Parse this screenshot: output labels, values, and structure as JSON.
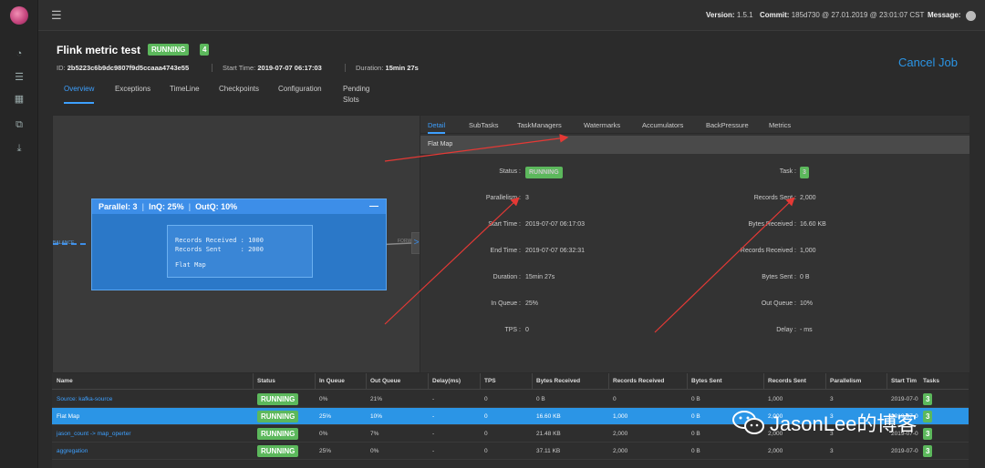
{
  "topbar": {
    "version_label": "Version:",
    "version": "1.5.1",
    "commit_label": "Commit:",
    "commit": "185d730 @ 27.01.2019 @ 23:01:07 CST",
    "message_label": "Message:"
  },
  "job": {
    "title": "Flink metric test",
    "status": "RUNNING",
    "tasks": "4",
    "id_label": "ID:",
    "id": "2b5223c6b9dc9807f9d5ccaaa4743e55",
    "start_label": "Start Time:",
    "start": "2019-07-07 06:17:03",
    "duration_label": "Duration:",
    "duration": "15min 27s",
    "cancel": "Cancel Job",
    "tabs": [
      "Overview",
      "Exceptions",
      "TimeLine",
      "Checkpoints",
      "Configuration",
      "Pending Slots"
    ]
  },
  "graph": {
    "node_parallel": "Parallel: 3",
    "node_inq": "InQ: 25%",
    "node_outq": "OutQ: 10%",
    "collapse": "—",
    "records_received": "Records Received : 1000",
    "records_sent": "Records Sent     : 2000",
    "operator": "Flat Map",
    "edge_in": "BALANCE",
    "edge_out": "FORW"
  },
  "side": {
    "tabs": [
      "Detail",
      "SubTasks",
      "TaskManagers",
      "Watermarks",
      "Accumulators",
      "BackPressure",
      "Metrics"
    ],
    "subtitle": "Flat Map",
    "left": [
      {
        "label": "Status :",
        "value": "RUNNING",
        "badge": true
      },
      {
        "label": "Parallelism :",
        "value": "3"
      },
      {
        "label": "Start Time :",
        "value": "2019-07-07 06:17:03"
      },
      {
        "label": "End Time :",
        "value": "2019-07-07 06:32:31"
      },
      {
        "label": "Duration :",
        "value": "15min 27s"
      },
      {
        "label": "In Queue :",
        "value": "25%"
      },
      {
        "label": "TPS :",
        "value": "0"
      }
    ],
    "right": [
      {
        "label": "Task :",
        "value": "3",
        "badge": true
      },
      {
        "label": "Records Sent :",
        "value": "2,000"
      },
      {
        "label": "Bytes Received :",
        "value": "16.60 KB"
      },
      {
        "label": "Records Received :",
        "value": "1,000"
      },
      {
        "label": "Bytes Sent :",
        "value": "0 B"
      },
      {
        "label": "Out Queue :",
        "value": "10%"
      },
      {
        "label": "Delay :",
        "value": "- ms"
      }
    ]
  },
  "table": {
    "headers": [
      "Name",
      "Status",
      "In Queue",
      "Out Queue",
      "Delay(ms)",
      "TPS",
      "Bytes Received",
      "Records Received",
      "Bytes Sent",
      "Records Sent",
      "Parallelism",
      "Start Tim",
      "Tasks"
    ],
    "rows": [
      [
        "Source: kafka-source",
        "RUNNING",
        "0%",
        "21%",
        "-",
        "0",
        "0 B",
        "0",
        "0 B",
        "1,000",
        "3",
        "2019-07-0",
        "3"
      ],
      [
        "Flat Map",
        "RUNNING",
        "25%",
        "10%",
        "-",
        "0",
        "16.60 KB",
        "1,000",
        "0 B",
        "2,000",
        "3",
        "2019-07-0",
        "3"
      ],
      [
        "jason_count -> map_operter",
        "RUNNING",
        "0%",
        "7%",
        "-",
        "0",
        "21.48 KB",
        "2,000",
        "0 B",
        "2,000",
        "3",
        "2019-07-0",
        "3"
      ],
      [
        "aggregation",
        "RUNNING",
        "25%",
        "0%",
        "-",
        "0",
        "37.11 KB",
        "2,000",
        "0 B",
        "2,000",
        "3",
        "2019-07-0",
        "3"
      ]
    ]
  },
  "watermark": "JasonLee的博客",
  "colors": {
    "accent": "#2b95e6",
    "running": "#5cb85c",
    "arrow": "#e53935"
  }
}
